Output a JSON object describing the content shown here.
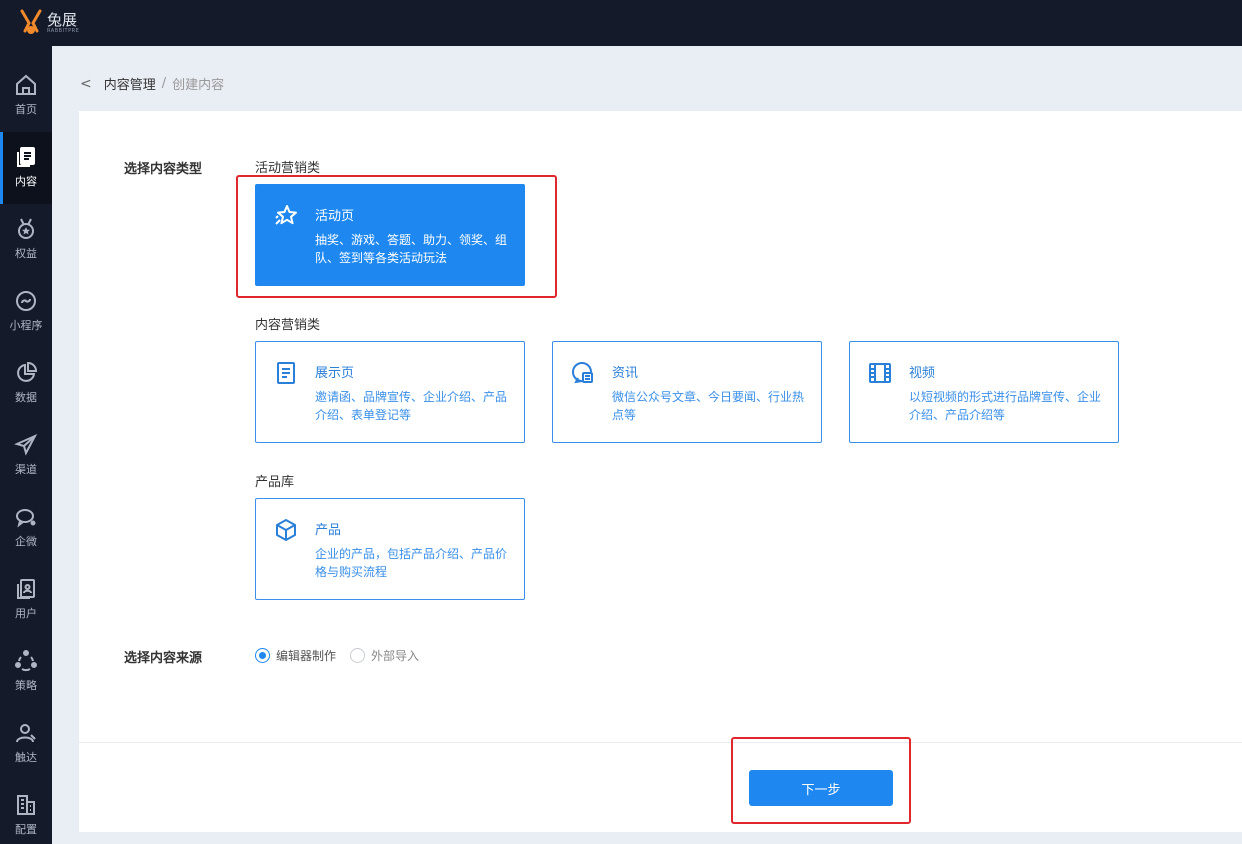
{
  "brand": {
    "name": "兔展",
    "sub": "RABBITPRE"
  },
  "sidebar": {
    "items": [
      {
        "label": "首页",
        "icon": "home-icon"
      },
      {
        "label": "内容",
        "icon": "content-icon",
        "active": true
      },
      {
        "label": "权益",
        "icon": "medal-icon"
      },
      {
        "label": "小程序",
        "icon": "mini-program-icon"
      },
      {
        "label": "数据",
        "icon": "pie-chart-icon"
      },
      {
        "label": "渠道",
        "icon": "paper-plane-icon"
      },
      {
        "label": "企微",
        "icon": "chat-icon"
      },
      {
        "label": "用户",
        "icon": "user-card-icon"
      },
      {
        "label": "策略",
        "icon": "strategy-icon"
      },
      {
        "label": "触达",
        "icon": "reach-user-icon"
      },
      {
        "label": "配置",
        "icon": "building-icon"
      }
    ]
  },
  "breadcrumb": {
    "back": "<",
    "parent": "内容管理",
    "separator": "/",
    "current": "创建内容"
  },
  "form": {
    "type_label": "选择内容类型",
    "source_label": "选择内容来源",
    "groups": {
      "activity": {
        "title": "活动营销类",
        "cards": [
          {
            "title": "活动页",
            "desc": "抽奖、游戏、答题、助力、领奖、组队、签到等各类活动玩法",
            "icon": "star-icon",
            "selected": true
          }
        ]
      },
      "content": {
        "title": "内容营销类",
        "cards": [
          {
            "title": "展示页",
            "desc": "邀请函、品牌宣传、企业介绍、产品介绍、表单登记等",
            "icon": "document-icon"
          },
          {
            "title": "资讯",
            "desc": "微信公众号文章、今日要闻、行业热点等",
            "icon": "news-icon"
          },
          {
            "title": "视频",
            "desc": "以短视频的形式进行品牌宣传、企业介绍、产品介绍等",
            "icon": "film-icon"
          }
        ]
      },
      "product": {
        "title": "产品库",
        "cards": [
          {
            "title": "产品",
            "desc": "企业的产品，包括产品介绍、产品价格与购买流程",
            "icon": "cube-icon"
          }
        ]
      }
    },
    "source_options": [
      {
        "label": "编辑器制作",
        "checked": true
      },
      {
        "label": "外部导入",
        "checked": false
      }
    ]
  },
  "actions": {
    "next_label": "下一步"
  },
  "colors": {
    "accent": "#1e88f0",
    "nav_bg": "#141a2a",
    "highlight": "#e0272e"
  }
}
